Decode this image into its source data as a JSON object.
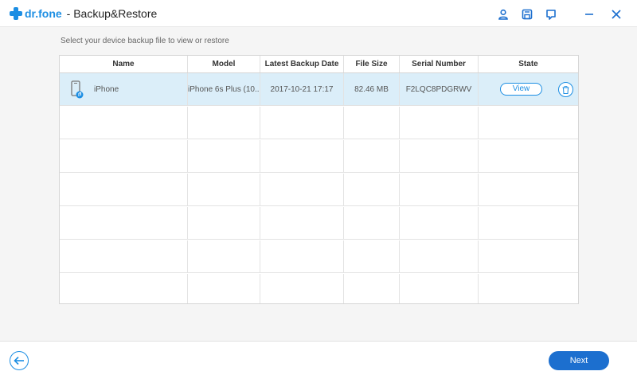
{
  "app": {
    "brand": "dr.fone",
    "title": "- Backup&Restore"
  },
  "title_icons": [
    "user-icon",
    "save-icon",
    "feedback-icon"
  ],
  "window_controls": [
    "minimize-icon",
    "close-icon"
  ],
  "instruction": "Select your device backup file to view or restore",
  "table": {
    "columns": {
      "name": "Name",
      "model": "Model",
      "date": "Latest Backup Date",
      "size": "File Size",
      "serial": "Serial Number",
      "state": "State"
    },
    "sort_column": "date",
    "rows": [
      {
        "name": "iPhone",
        "model": "iPhone 6s Plus (10...",
        "date": "2017-10-21 17:17",
        "size": "82.46 MB",
        "serial": "F2LQC8PDGRWV",
        "view_label": "View"
      }
    ]
  },
  "footer": {
    "next_label": "Next"
  },
  "colors": {
    "accent": "#1c8ee3",
    "selected_row": "#dbeef9",
    "next_button": "#1c6fcf"
  }
}
